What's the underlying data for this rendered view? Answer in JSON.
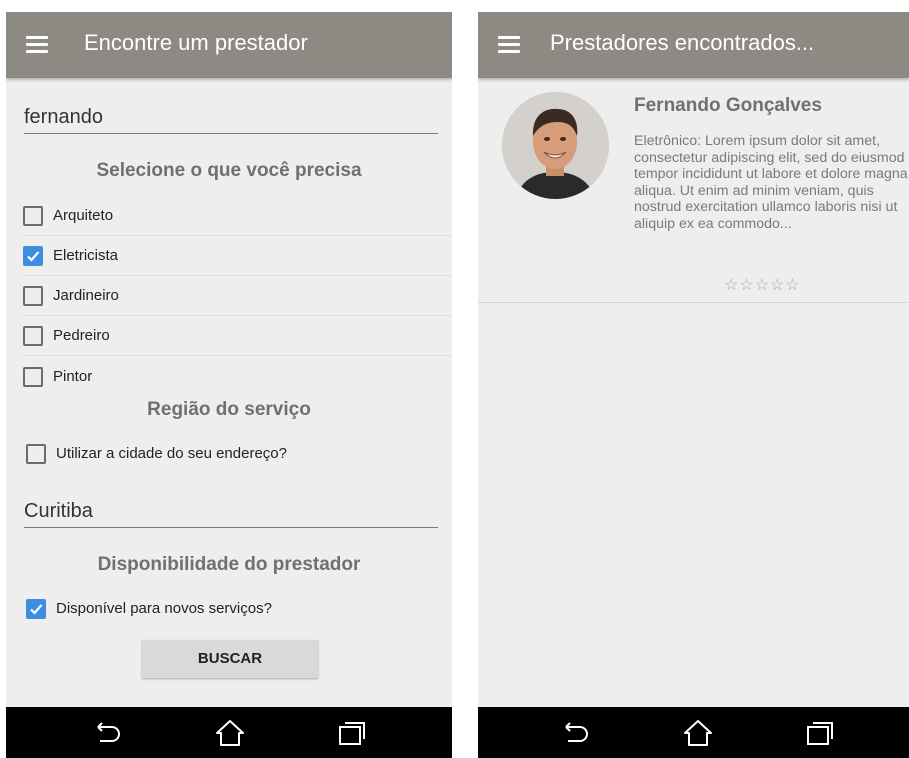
{
  "left": {
    "appbar": {
      "title": "Encontre um prestador",
      "menu_icon": "hamburger-icon"
    },
    "search": {
      "value": "fernando"
    },
    "services": {
      "heading": "Selecione o que você precisa",
      "items": [
        {
          "label": "Arquiteto",
          "checked": false
        },
        {
          "label": "Eletricista",
          "checked": true
        },
        {
          "label": "Jardineiro",
          "checked": false
        },
        {
          "label": "Pedreiro",
          "checked": false
        },
        {
          "label": "Pintor",
          "checked": false
        }
      ]
    },
    "region": {
      "heading": "Região do serviço",
      "use_address_label": "Utilizar a cidade do seu endereço?",
      "use_address_checked": false,
      "city": "Curitiba"
    },
    "availability": {
      "heading": "Disponibilidade do prestador",
      "available_label": "Disponível para novos serviços?",
      "available_checked": true
    },
    "search_button": "BUSCAR"
  },
  "right": {
    "appbar": {
      "title": "Prestadores encontrados...",
      "menu_icon": "hamburger-icon"
    },
    "results": [
      {
        "name": "Fernando Gonçalves",
        "description": "Eletrônico: Lorem ipsum dolor sit amet, consectetur adipiscing elit, sed do eiusmod tempor incididunt ut labore et dolore magna aliqua. Ut enim ad minim veniam, quis nostrud exercitation ullamco laboris nisi ut aliquip ex ea commodo...",
        "rating": 0,
        "rating_max": 5
      }
    ]
  },
  "navbar": {
    "icons": [
      "back-icon",
      "home-icon",
      "recents-icon"
    ]
  },
  "colors": {
    "appbar": "#8d8a84",
    "accent": "#3d8de1",
    "background": "#eeeeee",
    "heading_text": "#707070",
    "navbar": "#000000"
  }
}
